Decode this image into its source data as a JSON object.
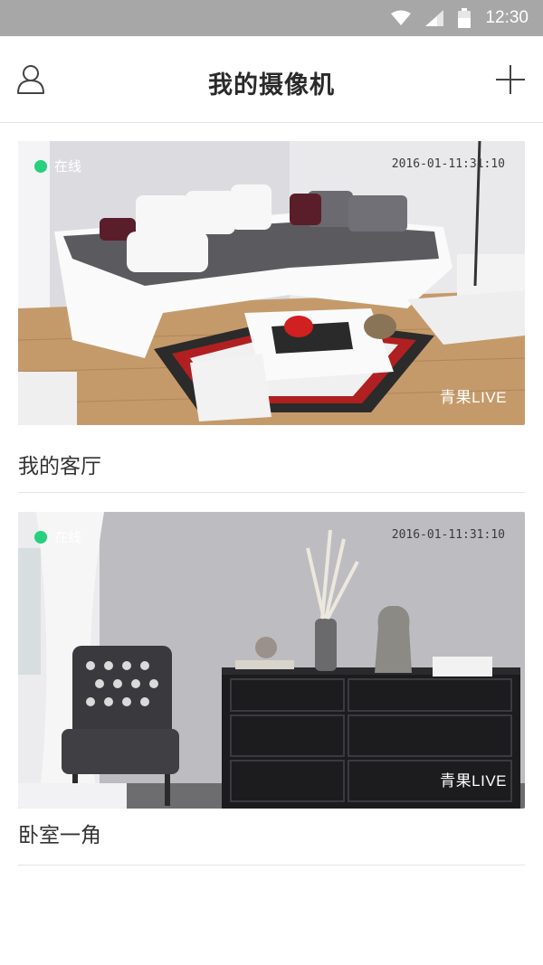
{
  "status_bar": {
    "time": "12:30",
    "icons": [
      "wifi-icon",
      "cellular-signal-icon",
      "battery-icon"
    ]
  },
  "header": {
    "title": "我的摄像机",
    "left_icon": "user-profile-icon",
    "right_icon": "add-icon"
  },
  "cameras": [
    {
      "status": "在线",
      "timestamp": "2016-01-11:31:10",
      "watermark": "青果LIVE",
      "name": "我的客厅"
    },
    {
      "status": "在线",
      "timestamp": "2016-01-11:31:10",
      "watermark": "青果LIVE",
      "name": "卧室一角"
    }
  ],
  "colors": {
    "online": "#26d07c",
    "status_bar": "#a7a7a7",
    "divider": "#e3e3e3"
  }
}
